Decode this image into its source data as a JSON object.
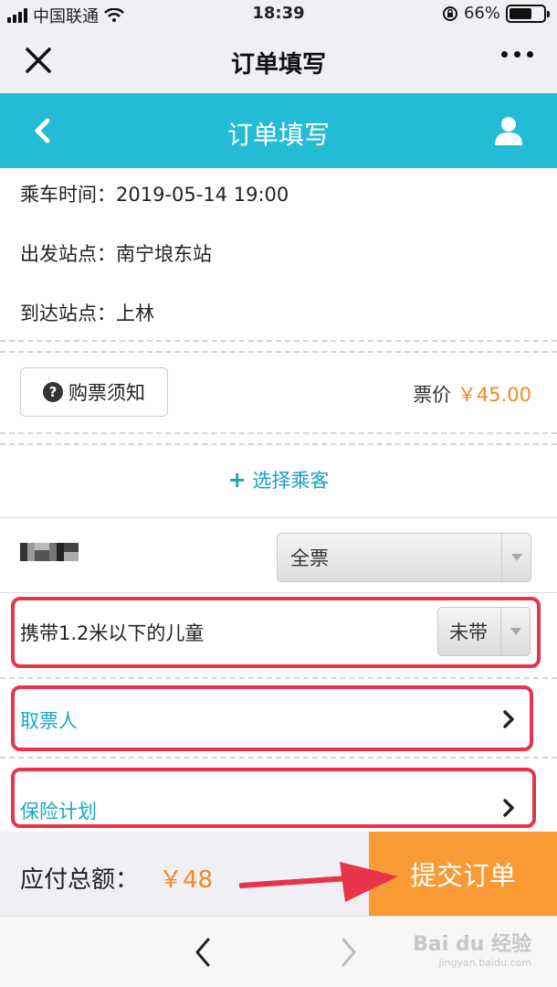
{
  "status_bar": {
    "carrier": "中国联通",
    "time": "18:39",
    "battery": "66%",
    "battery_level": 0.66
  },
  "wechat_nav": {
    "title": "订单填写"
  },
  "app_header": {
    "title": "订单填写"
  },
  "trip": {
    "time_label": "乘车时间：2019-05-14 19:00",
    "from_label": "出发站点：南宁埌东站",
    "to_label": "到达站点：上林"
  },
  "notice": {
    "button_label": "购票须知",
    "price_label": "票价",
    "price_value": "￥45.00"
  },
  "select_passenger": {
    "plus": "+",
    "label": "选择乘客"
  },
  "passenger": {
    "ticket_type": "全票"
  },
  "child": {
    "label": "携带1.2米以下的儿童",
    "value": "未带"
  },
  "ticket_collector": {
    "label": "取票人"
  },
  "insurance": {
    "label": "保险计划"
  },
  "footer": {
    "total_label": "应付总额：",
    "total_value": "￥48",
    "submit_label": "提交订单"
  },
  "watermark": {
    "brand": "Bai du 经验",
    "site": "jingyan.baidu.com"
  },
  "colors": {
    "accent": "#24bcd4",
    "orange": "#f99a35",
    "price": "#f08a24",
    "highlight": "#e8334a",
    "link": "#1aa7c8"
  }
}
